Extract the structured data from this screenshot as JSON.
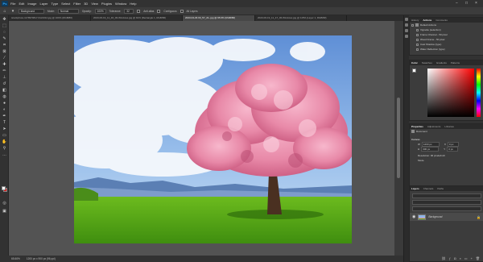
{
  "menubar": {
    "logo": "Ps",
    "items": [
      "File",
      "Edit",
      "Image",
      "Layer",
      "Type",
      "Select",
      "Filter",
      "3D",
      "View",
      "Plugins",
      "Window",
      "Help"
    ],
    "window_controls": [
      "−",
      "□",
      "×"
    ]
  },
  "options": {
    "tool_preset": "Background",
    "mode_label": "Mode:",
    "mode_value": "Normal",
    "opacity_label": "Opacity:",
    "opacity_value": "100%",
    "tolerance_label": "Tolerance:",
    "tolerance_value": "32",
    "anti_alias": "Anti-alias",
    "contiguous": "Contiguous",
    "all_layers": "All Layers"
  },
  "tabs": [
    {
      "label": "istockphoto-1178979817-612x612.jpg @ 100% (RGB/8#)",
      "active": false
    },
    {
      "label": "2023-06-19_11_46_06-Windows.jpg @ 91% (Rectangle 1, RGB/8#)",
      "active": false
    },
    {
      "label": "2023-04-29 00_57_21-.jpg @ 65.6% (RGB/8#)",
      "active": true
    },
    {
      "label": "2023-06-19_11_47_06-Windows.jpg @ 115% (Layer 1, RGB/8#)",
      "active": false
    }
  ],
  "status": {
    "zoom": "65.66%",
    "doc_size": "1200 px x 900 px (96 ppi)"
  },
  "panels": {
    "history_tabs": [
      "History",
      "Actions",
      "Comments"
    ],
    "actions": [
      {
        "label": "Default Actions",
        "folder": true
      },
      {
        "label": "Vignette (selection)"
      },
      {
        "label": "Frame Channel - 50 pixel"
      },
      {
        "label": "Wood Frame - 50 pixel"
      },
      {
        "label": "Cast Shadow (type)"
      },
      {
        "label": "Water Reflection (type)"
      }
    ],
    "color_tabs": [
      "Color",
      "Swatches",
      "Gradients",
      "Patterns"
    ],
    "properties_tabs": [
      "Properties",
      "Adjustments",
      "Libraries"
    ],
    "properties_doc": "Document",
    "canvas_label": "Canvas",
    "w_label": "W",
    "w_value": "1200 px",
    "h_label": "H",
    "h_value": "900 px",
    "x_label": "X",
    "x_value": "0 px",
    "y_label": "Y",
    "y_value": "0 px",
    "resolution": "Resolution: 96 pixels/inch",
    "mode_label": "Mode",
    "layers_tabs": [
      "Layers",
      "Channels",
      "Paths"
    ],
    "layer_name": "Background"
  },
  "colors": {
    "fg": "#ffffff",
    "bg": "#e31414",
    "picker_hue": "#ff0000"
  }
}
